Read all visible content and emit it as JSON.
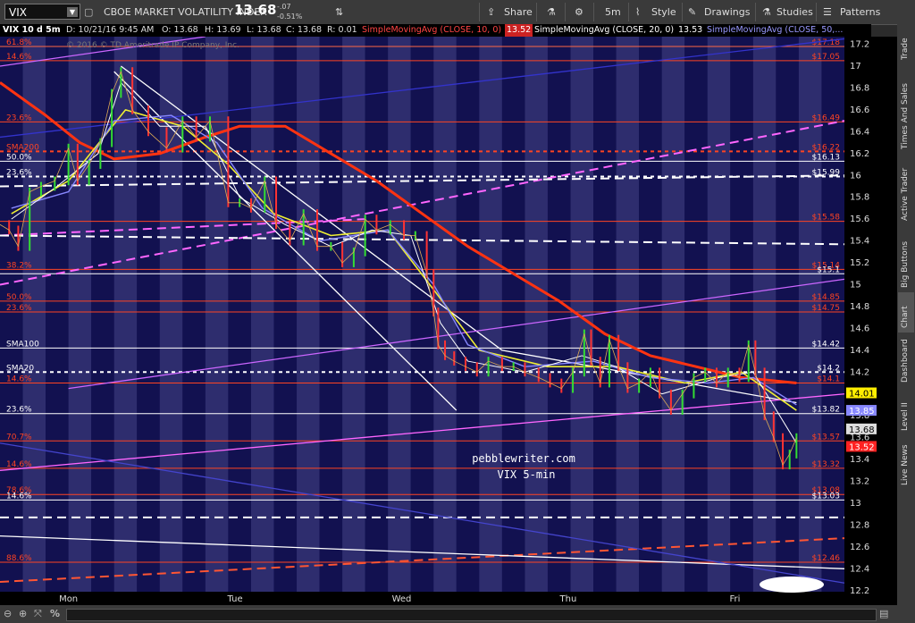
{
  "toolbar": {
    "symbol": "VIX",
    "description": "CBOE MARKET VOLATILITY INDEX",
    "last_price": "13.68",
    "change": "-.07",
    "change_pct": "-0.51%",
    "share": "Share",
    "timeframe": "5m",
    "style": "Style",
    "drawings": "Drawings",
    "studies": "Studies",
    "patterns": "Patterns"
  },
  "infobar": {
    "title": "VIX 10 d 5m",
    "date": "D: 10/21/16 9:45 AM",
    "open": "O: 13.68",
    "high": "H: 13.69",
    "low": "L: 13.68",
    "close": "C: 13.68",
    "range": "R: 0.01",
    "sma10_label": "SimpleMovingAvg (CLOSE, 10, 0)",
    "sma10_val": "13.52",
    "sma20_label": "SimpleMovingAvg (CLOSE, 20, 0)",
    "sma20_val": "13.53",
    "sma50_label": "SimpleMovingAvg (CLOSE, 50,...",
    "copyright": "© 2016 © TD Ameritrade IP Company, Inc."
  },
  "sidebar": [
    "Trade",
    "Times And Sales",
    "Active Trader",
    "Big Buttons",
    "Chart",
    "Dashboard",
    "Level II",
    "Live News"
  ],
  "chart_data": {
    "type": "line",
    "title": "VIX 10 d 5m",
    "days": [
      "Mon",
      "Tue",
      "Wed",
      "Thu",
      "Fri"
    ],
    "y_ticks": [
      12.2,
      12.4,
      12.6,
      12.8,
      13,
      13.2,
      13.4,
      13.6,
      13.8,
      14,
      14.2,
      14.4,
      14.6,
      14.8,
      15,
      15.2,
      15.4,
      15.6,
      15.8,
      16,
      16.2,
      16.4,
      16.6,
      16.8,
      17,
      17.2
    ],
    "ylim": [
      12.19,
      17.27
    ],
    "price_series": [
      {
        "t": 0,
        "v": 15.55
      },
      {
        "t": 0.4,
        "v": 15.5
      },
      {
        "t": 0.8,
        "v": 15.35
      },
      {
        "t": 1.3,
        "v": 15.85
      },
      {
        "t": 1.8,
        "v": 15.9
      },
      {
        "t": 2.4,
        "v": 15.95
      },
      {
        "t": 3.0,
        "v": 16.25
      },
      {
        "t": 3.4,
        "v": 15.95
      },
      {
        "t": 3.9,
        "v": 16.1
      },
      {
        "t": 4.4,
        "v": 16.3
      },
      {
        "t": 4.9,
        "v": 16.75
      },
      {
        "t": 5.3,
        "v": 16.95
      },
      {
        "t": 5.8,
        "v": 16.6
      },
      {
        "t": 6.5,
        "v": 16.4
      },
      {
        "t": 7.3,
        "v": 16.25
      },
      {
        "t": 8.0,
        "v": 16.5
      },
      {
        "t": 8.6,
        "v": 16.35
      },
      {
        "t": 9.2,
        "v": 16.5
      },
      {
        "t": 10.0,
        "v": 15.75
      },
      {
        "t": 10.5,
        "v": 15.75
      },
      {
        "t": 11.0,
        "v": 15.7
      },
      {
        "t": 11.6,
        "v": 15.95
      },
      {
        "t": 12.1,
        "v": 15.55
      },
      {
        "t": 12.7,
        "v": 15.4
      },
      {
        "t": 13.3,
        "v": 15.65
      },
      {
        "t": 13.9,
        "v": 15.35
      },
      {
        "t": 14.5,
        "v": 15.35
      },
      {
        "t": 15.0,
        "v": 15.2
      },
      {
        "t": 15.5,
        "v": 15.3
      },
      {
        "t": 16.0,
        "v": 15.6
      },
      {
        "t": 16.5,
        "v": 15.5
      },
      {
        "t": 17.1,
        "v": 15.55
      },
      {
        "t": 17.7,
        "v": 15.45
      },
      {
        "t": 18.2,
        "v": 15.45
      },
      {
        "t": 18.7,
        "v": 15.1
      },
      {
        "t": 19.0,
        "v": 14.75
      },
      {
        "t": 19.2,
        "v": 14.45
      },
      {
        "t": 19.5,
        "v": 14.35
      },
      {
        "t": 19.9,
        "v": 14.3
      },
      {
        "t": 20.4,
        "v": 14.25
      },
      {
        "t": 20.9,
        "v": 14.2
      },
      {
        "t": 21.4,
        "v": 14.3
      },
      {
        "t": 22.0,
        "v": 14.25
      },
      {
        "t": 22.5,
        "v": 14.25
      },
      {
        "t": 23.0,
        "v": 14.2
      },
      {
        "t": 23.6,
        "v": 14.15
      },
      {
        "t": 24.1,
        "v": 14.1
      },
      {
        "t": 24.6,
        "v": 14.05
      },
      {
        "t": 25.1,
        "v": 14.2
      },
      {
        "t": 25.6,
        "v": 14.55
      },
      {
        "t": 25.9,
        "v": 14.3
      },
      {
        "t": 26.3,
        "v": 14.1
      },
      {
        "t": 26.7,
        "v": 14.5
      },
      {
        "t": 27.1,
        "v": 14.25
      },
      {
        "t": 27.5,
        "v": 14.05
      },
      {
        "t": 28.0,
        "v": 14.1
      },
      {
        "t": 28.5,
        "v": 14.2
      },
      {
        "t": 28.9,
        "v": 14.0
      },
      {
        "t": 29.4,
        "v": 13.85
      },
      {
        "t": 29.9,
        "v": 14.0
      },
      {
        "t": 30.4,
        "v": 14.15
      },
      {
        "t": 30.9,
        "v": 14.2
      },
      {
        "t": 31.4,
        "v": 14.1
      },
      {
        "t": 31.9,
        "v": 14.2
      },
      {
        "t": 32.4,
        "v": 14.15
      },
      {
        "t": 32.8,
        "v": 14.45
      },
      {
        "t": 33.1,
        "v": 14.2
      },
      {
        "t": 33.5,
        "v": 13.8
      },
      {
        "t": 33.9,
        "v": 13.6
      },
      {
        "t": 34.3,
        "v": 13.35
      },
      {
        "t": 34.6,
        "v": 13.45
      },
      {
        "t": 34.9,
        "v": 13.6
      }
    ],
    "sma10_series": [
      {
        "t": 0.5,
        "v": 15.6
      },
      {
        "t": 2.5,
        "v": 15.9
      },
      {
        "t": 4.3,
        "v": 16.2
      },
      {
        "t": 5.3,
        "v": 16.85
      },
      {
        "t": 7.0,
        "v": 16.45
      },
      {
        "t": 9.0,
        "v": 16.45
      },
      {
        "t": 10.5,
        "v": 15.8
      },
      {
        "t": 12.5,
        "v": 15.55
      },
      {
        "t": 14.5,
        "v": 15.35
      },
      {
        "t": 16.3,
        "v": 15.5
      },
      {
        "t": 18.0,
        "v": 15.45
      },
      {
        "t": 19.3,
        "v": 14.65
      },
      {
        "t": 20.5,
        "v": 14.3
      },
      {
        "t": 23.0,
        "v": 14.2
      },
      {
        "t": 25.5,
        "v": 14.35
      },
      {
        "t": 27.0,
        "v": 14.25
      },
      {
        "t": 29.0,
        "v": 14.0
      },
      {
        "t": 31.5,
        "v": 14.15
      },
      {
        "t": 33.0,
        "v": 14.2
      },
      {
        "t": 34.9,
        "v": 13.55
      }
    ],
    "sma20_series": [
      {
        "t": 0.5,
        "v": 15.7
      },
      {
        "t": 3.0,
        "v": 15.85
      },
      {
        "t": 5.0,
        "v": 16.5
      },
      {
        "t": 7.5,
        "v": 16.55
      },
      {
        "t": 9.5,
        "v": 16.3
      },
      {
        "t": 11.5,
        "v": 15.7
      },
      {
        "t": 14.0,
        "v": 15.4
      },
      {
        "t": 17.0,
        "v": 15.5
      },
      {
        "t": 19.0,
        "v": 15.0
      },
      {
        "t": 20.5,
        "v": 14.45
      },
      {
        "t": 23.0,
        "v": 14.25
      },
      {
        "t": 26.0,
        "v": 14.3
      },
      {
        "t": 28.5,
        "v": 14.15
      },
      {
        "t": 31.0,
        "v": 14.1
      },
      {
        "t": 33.0,
        "v": 14.15
      },
      {
        "t": 34.9,
        "v": 13.9
      }
    ],
    "sma50_series": [
      {
        "t": 0.5,
        "v": 15.65
      },
      {
        "t": 3.0,
        "v": 15.95
      },
      {
        "t": 5.5,
        "v": 16.6
      },
      {
        "t": 8.0,
        "v": 16.45
      },
      {
        "t": 10.0,
        "v": 16.1
      },
      {
        "t": 12.0,
        "v": 15.65
      },
      {
        "t": 14.5,
        "v": 15.45
      },
      {
        "t": 17.0,
        "v": 15.5
      },
      {
        "t": 19.2,
        "v": 14.9
      },
      {
        "t": 21.0,
        "v": 14.4
      },
      {
        "t": 24.0,
        "v": 14.25
      },
      {
        "t": 27.0,
        "v": 14.25
      },
      {
        "t": 30.0,
        "v": 14.1
      },
      {
        "t": 32.5,
        "v": 14.2
      },
      {
        "t": 34.9,
        "v": 13.85
      }
    ],
    "sma200_series": [
      {
        "t": 0,
        "v": 16.85
      },
      {
        "t": 2.0,
        "v": 16.55
      },
      {
        "t": 3.5,
        "v": 16.3
      },
      {
        "t": 5.0,
        "v": 16.15
      },
      {
        "t": 7.0,
        "v": 16.2
      },
      {
        "t": 9.0,
        "v": 16.35
      },
      {
        "t": 10.5,
        "v": 16.45
      },
      {
        "t": 12.5,
        "v": 16.45
      },
      {
        "t": 14.5,
        "v": 16.2
      },
      {
        "t": 16.5,
        "v": 15.95
      },
      {
        "t": 18.5,
        "v": 15.65
      },
      {
        "t": 20.5,
        "v": 15.35
      },
      {
        "t": 22.5,
        "v": 15.1
      },
      {
        "t": 24.5,
        "v": 14.85
      },
      {
        "t": 26.5,
        "v": 14.55
      },
      {
        "t": 28.5,
        "v": 14.35
      },
      {
        "t": 30.5,
        "v": 14.25
      },
      {
        "t": 32.5,
        "v": 14.15
      },
      {
        "t": 34.9,
        "v": 14.1
      }
    ],
    "trendlines": [
      {
        "color": "#ffffff",
        "points": [
          [
            5.3,
            17.0
          ],
          [
            22.0,
            14.4
          ],
          [
            34.9,
            13.92
          ]
        ]
      },
      {
        "color": "#ffffff",
        "points": [
          [
            5.0,
            16.95
          ],
          [
            20.0,
            13.85
          ]
        ]
      },
      {
        "color": "#ff66ff",
        "points": [
          [
            0,
            13.3
          ],
          [
            37.0,
            14.0
          ]
        ]
      },
      {
        "color": "#cc66ff",
        "points": [
          [
            3.0,
            14.05
          ],
          [
            37.0,
            15.05
          ]
        ]
      },
      {
        "color": "#ff66ff",
        "dash": true,
        "points": [
          [
            0,
            15.0
          ],
          [
            37.0,
            16.5
          ]
        ]
      },
      {
        "color": "#ff66ff",
        "dash": true,
        "points": [
          [
            0,
            15.45
          ],
          [
            16.0,
            15.6
          ]
        ]
      },
      {
        "color": "#ffffff",
        "dash": true,
        "points": [
          [
            0,
            15.45
          ],
          [
            37.0,
            15.37
          ]
        ]
      },
      {
        "color": "#ffffff",
        "dash": true,
        "points": [
          [
            0,
            15.9
          ],
          [
            37.0,
            16.0
          ]
        ]
      },
      {
        "color": "#ff5533",
        "dash": true,
        "points": [
          [
            0,
            12.28
          ],
          [
            37.0,
            12.68
          ]
        ]
      },
      {
        "color": "#ffffff",
        "dash": true,
        "points": [
          [
            0,
            12.87
          ],
          [
            37.0,
            12.87
          ]
        ]
      },
      {
        "color": "#cc66ff",
        "points": [
          [
            0,
            17.0
          ],
          [
            9.0,
            17.27
          ]
        ]
      },
      {
        "color": "#3333cc",
        "points": [
          [
            0,
            16.35
          ],
          [
            37.0,
            17.25
          ]
        ]
      },
      {
        "color": "#ffffff",
        "points": [
          [
            0,
            12.7
          ],
          [
            37.0,
            12.4
          ]
        ]
      },
      {
        "color": "#4444cc",
        "points": [
          [
            0,
            13.55
          ],
          [
            37.0,
            12.27
          ]
        ]
      }
    ],
    "hlines": [
      {
        "v": 17.18,
        "color": "#ff6644",
        "label": "$17.18",
        "left": "61.8%"
      },
      {
        "v": 17.05,
        "color": "#ff4422",
        "label": "$17.05",
        "left": "14.6%"
      },
      {
        "v": 16.49,
        "color": "#ff4422",
        "label": "$16.49",
        "left": "23.6%"
      },
      {
        "v": 16.22,
        "color": "#ff4422",
        "dash": true,
        "label": "$16.22",
        "left": "SMA200"
      },
      {
        "v": 16.13,
        "color": "#ffffff",
        "label": "$16.13",
        "left": "50.0%"
      },
      {
        "v": 15.99,
        "color": "#ffffff",
        "dash": true,
        "label": "$15.99",
        "left": "23.6%"
      },
      {
        "v": 15.58,
        "color": "#ff4422",
        "label": "$15.58",
        "left": ""
      },
      {
        "v": 15.14,
        "color": "#ff4422",
        "label": "$15.14",
        "left": "38.2%"
      },
      {
        "v": 15.1,
        "color": "#ffffff",
        "label": "$15.1",
        "left": ""
      },
      {
        "v": 14.85,
        "color": "#ff4422",
        "label": "$14.85",
        "left": "50.0%"
      },
      {
        "v": 14.75,
        "color": "#ff4422",
        "label": "$14.75",
        "left": "23.6%"
      },
      {
        "v": 14.42,
        "color": "#ffffff",
        "label": "$14.42",
        "left": "SMA100"
      },
      {
        "v": 14.2,
        "color": "#ffffff",
        "dash": true,
        "label": "$14.2",
        "left": "SMA20"
      },
      {
        "v": 14.1,
        "color": "#ff4422",
        "label": "$14.1",
        "left": "14.6%"
      },
      {
        "v": 13.82,
        "color": "#ffffff",
        "label": "$13.82",
        "left": "23.6%"
      },
      {
        "v": 13.57,
        "color": "#ff4422",
        "label": "$13.57",
        "left": "70.7%"
      },
      {
        "v": 13.32,
        "color": "#ff4422",
        "label": "$13.32",
        "left": "14.6%"
      },
      {
        "v": 13.08,
        "color": "#ff4422",
        "label": "$13.08",
        "left": "78.6%"
      },
      {
        "v": 13.03,
        "color": "#ffffff",
        "label": "$13.03",
        "left": "14.6%"
      },
      {
        "v": 12.46,
        "color": "#ff4422",
        "label": "$12.46",
        "left": "88.6%"
      }
    ],
    "price_tags": [
      {
        "v": 14.01,
        "label": "14.01",
        "bg": "#ffee00",
        "fg": "#000000"
      },
      {
        "v": 13.85,
        "label": "13.85",
        "bg": "#8888ff",
        "fg": "#ffffff"
      },
      {
        "v": 13.68,
        "label": "13.68",
        "bg": "#dddddd",
        "fg": "#000000"
      },
      {
        "v": 13.52,
        "label": "13.52",
        "bg": "#ff2222",
        "fg": "#ffffff"
      }
    ],
    "annotation_line1": "pebblewriter.com",
    "annotation_line2": "VIX 5-min"
  }
}
